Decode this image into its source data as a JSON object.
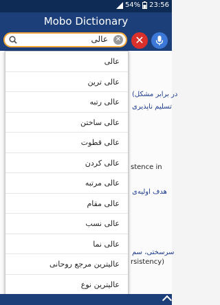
{
  "status": {
    "battery": "54%",
    "time": "23:56"
  },
  "app_title": "Mobo Dictionary",
  "search": {
    "value": "عالی"
  },
  "suggestions": [
    "عالی",
    "عالی ترین",
    "عالی رتبه",
    "عالی ساختن",
    "عالی قطوت",
    "عالی کردن",
    "عالی مرتبه",
    "عالی مقام",
    "عالی نسب",
    "عالی نما",
    "عالیترین مرجع روحانی",
    "عالیترین نوع"
  ],
  "background_text": {
    "line1": "(در برابر مشکل",
    "line2": "تسلیم ناپذیری",
    "line3": "stence in",
    "line4": "هدف اولیه‌ی",
    "line5": "سرسختی، سم",
    "line6": "rsistency)"
  },
  "colors": {
    "titlebar": "#1c3f7a",
    "statusbar": "#0d2b55",
    "accent_border": "#f3a73a",
    "clear_red": "#d9302c",
    "mic_blue": "#3c78d8"
  }
}
